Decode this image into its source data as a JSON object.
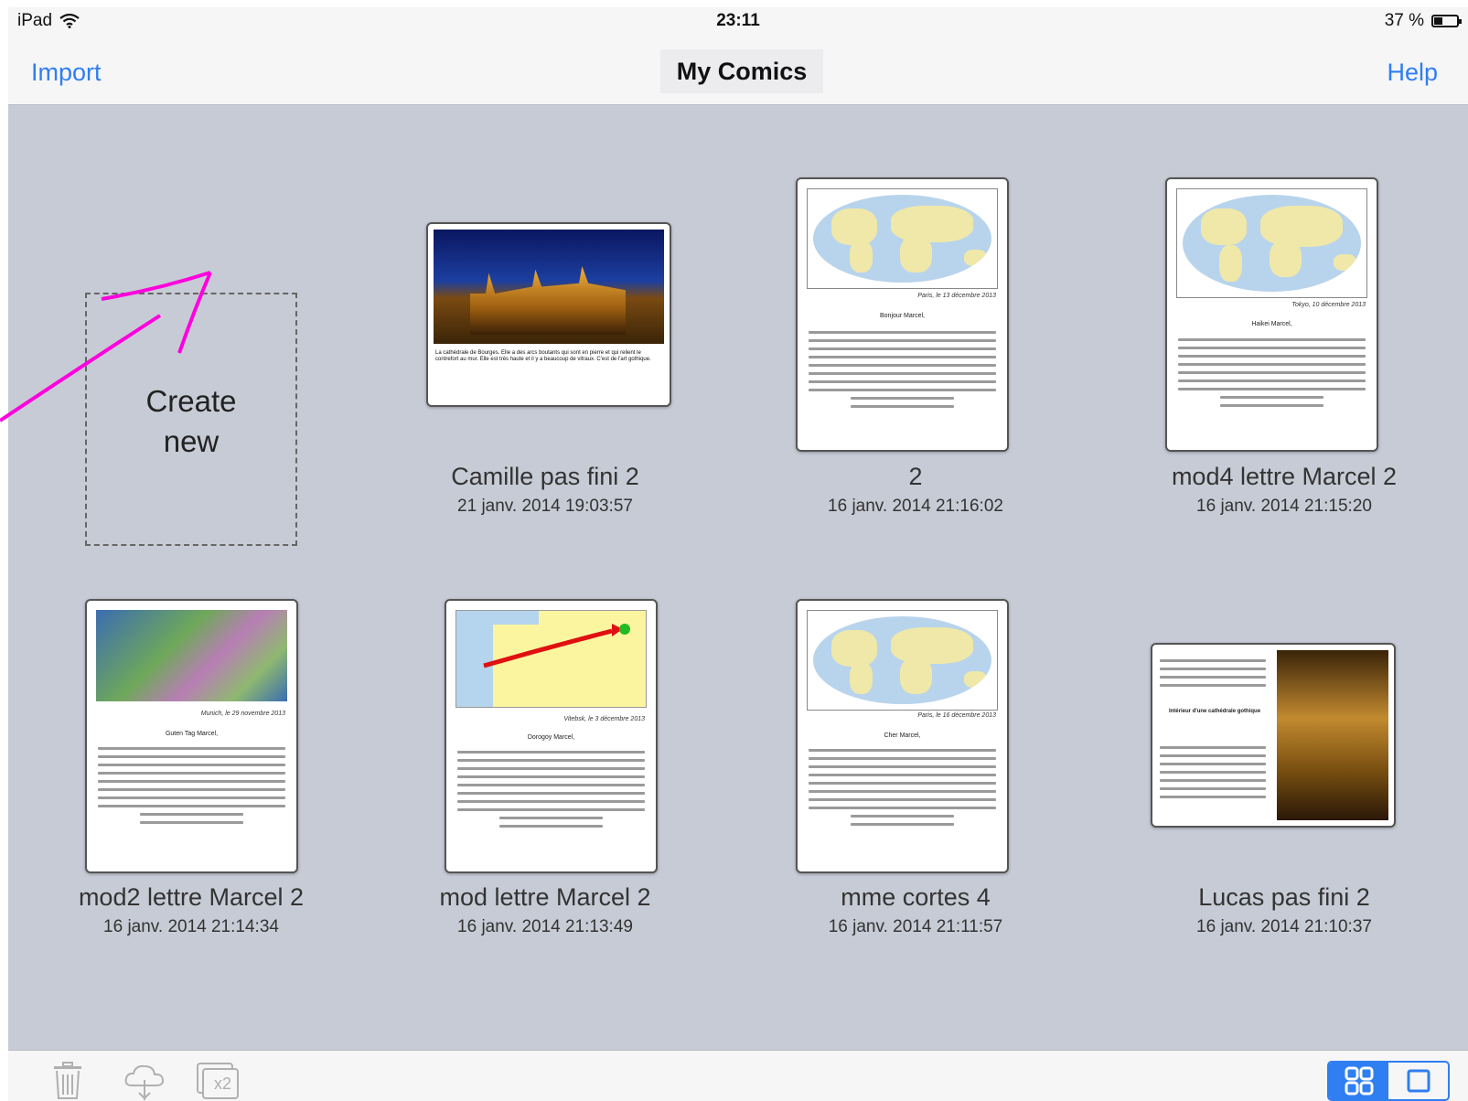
{
  "status": {
    "device": "iPad",
    "time": "23:11",
    "battery": "37 %"
  },
  "nav": {
    "import": "Import",
    "title": "My Comics",
    "help": "Help"
  },
  "create": {
    "label_line1": "Create",
    "label_line2": "new"
  },
  "comics": [
    {
      "name": "Camille pas fini 2",
      "date": "21 janv. 2014 19:03:57",
      "caption": "La cathédrale de Bourges.\nElle a des arcs boutants qui sont en pierre et qui relient le contrefort au mur. Elle est très haute et il y a beaucoup de vitraux. C'est de l'art gothique."
    },
    {
      "name": "2",
      "date": "16 janv. 2014 21:16:02",
      "place": "Paris, le 13 décembre 2013",
      "greeting": "Bonjour Marcel,"
    },
    {
      "name": "mod4 lettre Marcel 2",
      "date": "16 janv. 2014 21:15:20",
      "place": "Tokyo, 10 décembre 2013",
      "greeting": "Haikei Marcel,"
    },
    {
      "name": "mod2 lettre Marcel 2",
      "date": "16 janv. 2014 21:14:34",
      "place": "Munich, le 29 novembre 2013",
      "greeting": "Guten Tag Marcel,"
    },
    {
      "name": "mod lettre Marcel  2",
      "date": "16 janv. 2014 21:13:49",
      "place": "Vitebsk, le 3 décembre 2013",
      "greeting": "Dorogoy Marcel,"
    },
    {
      "name": "mme cortes 4",
      "date": "16 janv. 2014 21:11:57",
      "place": "Paris, le 16 décembre 2013",
      "greeting": "Cher Marcel,"
    },
    {
      "name": "Lucas pas fini 2",
      "date": "16 janv. 2014 21:10:37",
      "heading": "Intérieur d'une cathédrale gothique"
    }
  ],
  "toolbar": {
    "icons": [
      "trash-icon",
      "cloud-upload-icon",
      "duplicate-x2-icon"
    ],
    "duplicate_label": "x2",
    "view_modes": [
      "grid-view-icon",
      "single-view-icon"
    ]
  },
  "colors": {
    "accent": "#2f7ef2",
    "annotation": "#ff00dd",
    "background": "#c7cbd6"
  }
}
